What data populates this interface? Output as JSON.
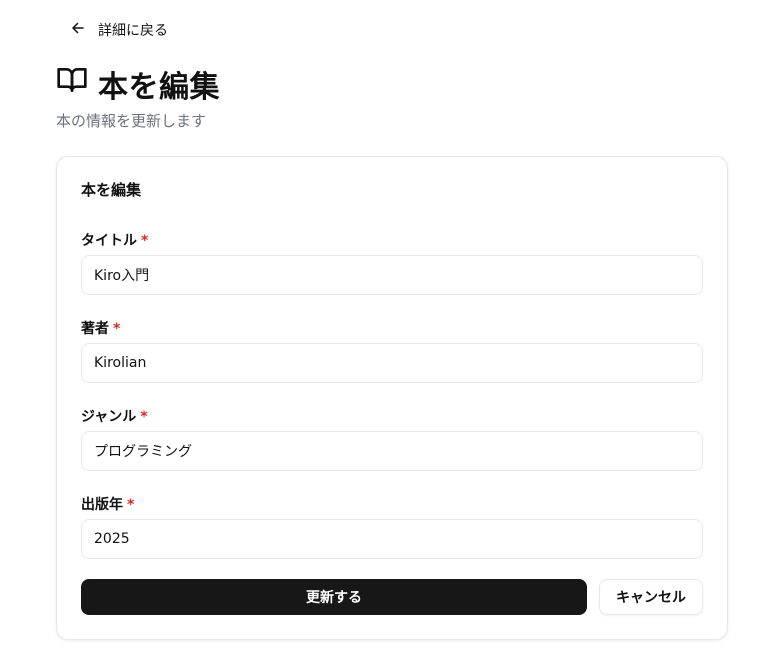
{
  "nav": {
    "back_label": "詳細に戻る",
    "back_icon": "arrow-left-icon"
  },
  "header": {
    "title": "本を編集",
    "title_icon": "open-book-icon",
    "subtitle": "本の情報を更新します"
  },
  "form": {
    "card_title": "本を編集",
    "required_marker": "*",
    "fields": [
      {
        "label": "タイトル",
        "value": "Kiro入門"
      },
      {
        "label": "著者",
        "value": "Kirolian"
      },
      {
        "label": "ジャンル",
        "value": "プログラミング"
      },
      {
        "label": "出版年",
        "value": "2025"
      }
    ],
    "submit_label": "更新する",
    "cancel_label": "キャンセル"
  },
  "colors": {
    "primary": "#171717",
    "required": "#dc2626",
    "muted": "#6b7280",
    "border": "#e5e7eb"
  }
}
